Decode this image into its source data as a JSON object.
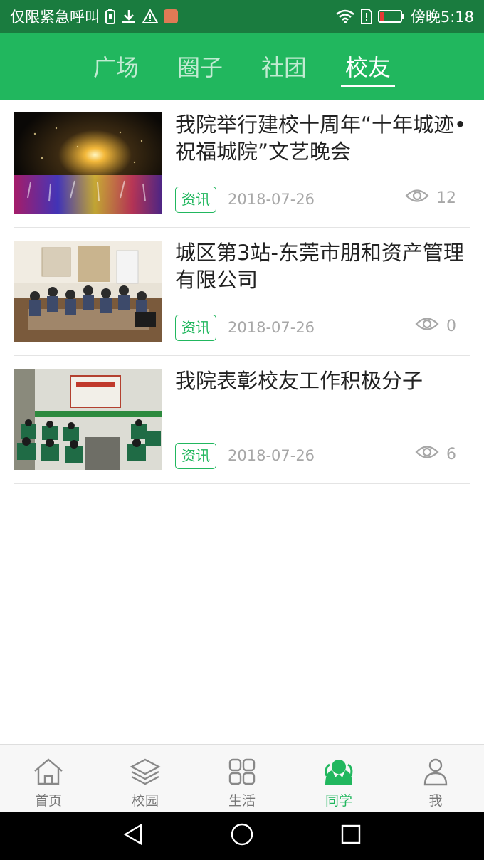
{
  "status_bar": {
    "carrier_text": "仅限紧急呼叫",
    "time": "傍晚5:18"
  },
  "top_tabs": [
    {
      "label": "广场",
      "active": false
    },
    {
      "label": "圈子",
      "active": false
    },
    {
      "label": "社团",
      "active": false
    },
    {
      "label": "校友",
      "active": true
    }
  ],
  "articles": [
    {
      "title": "我院举行建校十周年“十年城迹•祝福城院”文艺晚会",
      "tag": "资讯",
      "date": "2018-07-26",
      "views": "12",
      "thumbnail": "concert-photo"
    },
    {
      "title": "城区第3站-东莞市朋和资产管理有限公司",
      "tag": "资讯",
      "date": "2018-07-26",
      "views": "0",
      "thumbnail": "meeting-photo"
    },
    {
      "title": "我院表彰校友工作积极分子",
      "tag": "资讯",
      "date": "2018-07-26",
      "views": "6",
      "thumbnail": "auditorium-photo"
    }
  ],
  "bottom_nav": [
    {
      "label": "首页",
      "icon": "home-icon",
      "active": false
    },
    {
      "label": "校园",
      "icon": "layers-icon",
      "active": false
    },
    {
      "label": "生活",
      "icon": "grid-icon",
      "active": false
    },
    {
      "label": "同学",
      "icon": "classmates-icon",
      "active": true
    },
    {
      "label": "我",
      "icon": "person-icon",
      "active": false
    }
  ],
  "colors": {
    "brand_green": "#21b75e",
    "status_bar": "#1a7c3f",
    "meta_gray": "#a7a7a7"
  }
}
